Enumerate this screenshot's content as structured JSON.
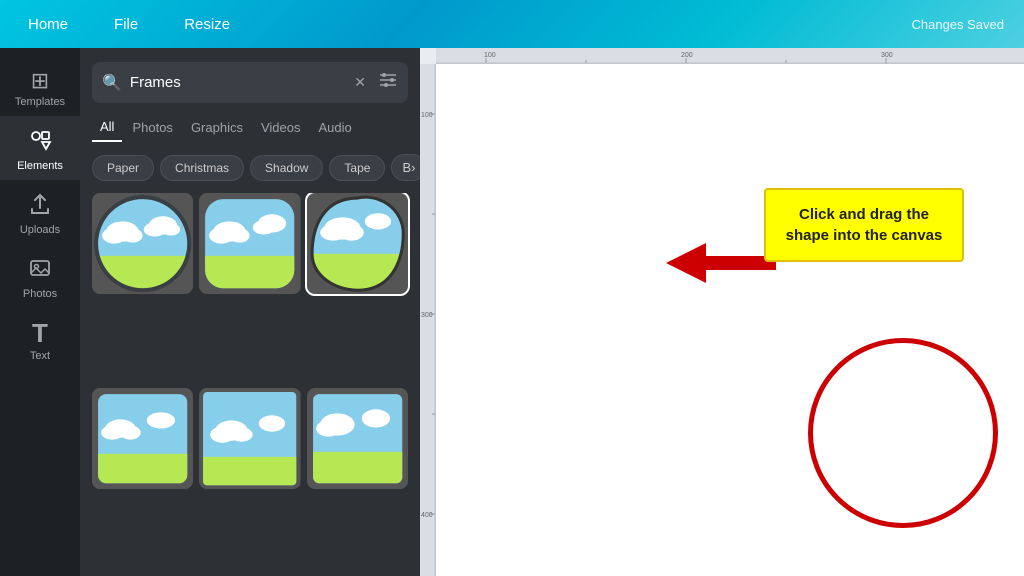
{
  "topnav": {
    "items": [
      "Home",
      "File",
      "Resize"
    ],
    "status": "Changes Saved"
  },
  "sidebar": {
    "items": [
      {
        "id": "templates",
        "icon": "⊞",
        "label": "Templates"
      },
      {
        "id": "elements",
        "icon": "❖",
        "label": "Elements"
      },
      {
        "id": "uploads",
        "icon": "⬆",
        "label": "Uploads"
      },
      {
        "id": "photos",
        "icon": "🖼",
        "label": "Photos"
      },
      {
        "id": "text",
        "icon": "T",
        "label": "Text"
      }
    ]
  },
  "panel": {
    "search": {
      "value": "Frames",
      "placeholder": "Search"
    },
    "tabs": [
      "All",
      "Photos",
      "Graphics",
      "Videos",
      "Audio"
    ],
    "active_tab": "All",
    "chips": [
      "Paper",
      "Christmas",
      "Shadow",
      "Tape",
      "B..."
    ]
  },
  "annotation": {
    "text": "Click and drag the shape into the canvas"
  }
}
